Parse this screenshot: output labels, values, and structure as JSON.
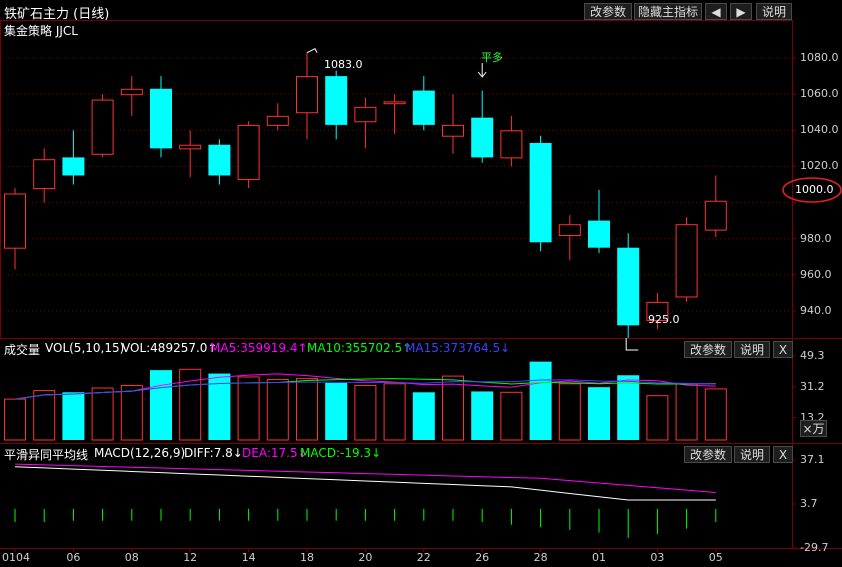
{
  "header": {
    "title": "铁矿石主力 (日线)",
    "subtitle": "集金策略 JJCL",
    "buttons": {
      "params": "改参数",
      "hide": "隐藏主指标",
      "left": "◀",
      "right": "▶",
      "help": "说明"
    }
  },
  "main": {
    "annotations": {
      "high": "1083.0",
      "low": "925.0",
      "signal": "平多"
    },
    "price_axis": [
      "1080.0",
      "1060.0",
      "1040.0",
      "1020.0",
      "1000.0",
      "980.0",
      "960.0",
      "940.0"
    ],
    "highlight_label": "1000.0",
    "highlight_color": "#e02020"
  },
  "volume": {
    "label": "成交量",
    "vol": "VOL(5,10,15)",
    "volv": "VOL:489257.0↑",
    "ma5": "MA5:359919.4↑",
    "ma10": "MA10:355702.5↑",
    "ma15": "MA15:373764.5↓",
    "axis": [
      "49.3",
      "31.2",
      "13.2"
    ],
    "unit_button": "×万",
    "buttons": {
      "params": "改参数",
      "help": "说明",
      "close": "X"
    }
  },
  "macd": {
    "label": "平滑异同平均线",
    "macd_params": "MACD(12,26,9)",
    "diff": "DIFF:7.8↓",
    "dea": "DEA:17.5↓",
    "macd": "MACD:-19.3↓",
    "axis": [
      "37.1",
      "3.7",
      "-29.7"
    ],
    "buttons": {
      "params": "改参数",
      "help": "说明",
      "close": "X"
    }
  },
  "date_axis": [
    "0104",
    "06",
    "08",
    "12",
    "14",
    "18",
    "20",
    "22",
    "26",
    "28",
    "01",
    "03",
    "05"
  ],
  "colors": {
    "up": "#ff3232",
    "down": "#00ffff",
    "border": "#7a0000",
    "ma5": "#ff00ff",
    "ma10": "#00ff00",
    "ma15": "#4040ff",
    "diff": "#ffffff",
    "dea": "#ff00ff"
  },
  "chart_data": {
    "type": "candlestick",
    "ylim": [
      925,
      1090
    ],
    "bars": [
      {
        "open": 975,
        "close": 1005,
        "high": 1008,
        "low": 963,
        "volume": 24.0,
        "macd": -10
      },
      {
        "open": 1008,
        "close": 1024,
        "high": 1030,
        "low": 1000,
        "volume": 29.0,
        "macd": -10
      },
      {
        "open": 1025,
        "close": 1015,
        "high": 1040,
        "low": 1010,
        "volume": 28.0,
        "macd": -9
      },
      {
        "open": 1027,
        "close": 1057,
        "high": 1060,
        "low": 1025,
        "volume": 30.5,
        "macd": -9
      },
      {
        "open": 1060,
        "close": 1063,
        "high": 1070,
        "low": 1048,
        "volume": 32.0,
        "macd": -9
      },
      {
        "open": 1063,
        "close": 1030,
        "high": 1070,
        "low": 1025,
        "volume": 41.0,
        "macd": -9
      },
      {
        "open": 1030,
        "close": 1032,
        "high": 1040,
        "low": 1014,
        "volume": 41.5,
        "macd": -9
      },
      {
        "open": 1032,
        "close": 1015,
        "high": 1035,
        "low": 1010,
        "volume": 39.0,
        "macd": -9
      },
      {
        "open": 1013,
        "close": 1043,
        "high": 1045,
        "low": 1008,
        "volume": 37.0,
        "macd": -9
      },
      {
        "open": 1043,
        "close": 1048,
        "high": 1055,
        "low": 1040,
        "volume": 35.5,
        "macd": -9
      },
      {
        "open": 1050,
        "close": 1070,
        "high": 1083,
        "low": 1035,
        "volume": 36.0,
        "macd": -9
      },
      {
        "open": 1070,
        "close": 1043,
        "high": 1073,
        "low": 1035,
        "volume": 33.5,
        "macd": -9
      },
      {
        "open": 1045,
        "close": 1053,
        "high": 1058,
        "low": 1030,
        "volume": 32.0,
        "macd": -9
      },
      {
        "open": 1055,
        "close": 1056,
        "high": 1060,
        "low": 1038,
        "volume": 33.0,
        "macd": -9
      },
      {
        "open": 1062,
        "close": 1043,
        "high": 1070,
        "low": 1040,
        "volume": 28.0,
        "macd": -9
      },
      {
        "open": 1037,
        "close": 1043,
        "high": 1060,
        "low": 1027,
        "volume": 37.5,
        "macd": -9
      },
      {
        "open": 1047,
        "close": 1025,
        "high": 1062,
        "low": 1022,
        "volume": 28.5,
        "macd": -10
      },
      {
        "open": 1025,
        "close": 1040,
        "high": 1048,
        "low": 1020,
        "volume": 28.0,
        "macd": -12
      },
      {
        "open": 1033,
        "close": 978,
        "high": 1037,
        "low": 973,
        "volume": 46.0,
        "macd": -14
      },
      {
        "open": 982,
        "close": 988,
        "high": 993,
        "low": 968,
        "volume": 33.0,
        "macd": -16
      },
      {
        "open": 990,
        "close": 975,
        "high": 1007,
        "low": 972,
        "volume": 31.0,
        "macd": -18
      },
      {
        "open": 975,
        "close": 932,
        "high": 983,
        "low": 925,
        "volume": 38.0,
        "macd": -22
      },
      {
        "open": 935,
        "close": 945,
        "high": 950,
        "low": 930,
        "volume": 26.0,
        "macd": -19
      },
      {
        "open": 948,
        "close": 988,
        "high": 992,
        "low": 945,
        "volume": 33.0,
        "macd": -15
      },
      {
        "open": 985,
        "close": 1001,
        "high": 1015,
        "low": 981,
        "volume": 30.0,
        "macd": -10
      }
    ]
  }
}
